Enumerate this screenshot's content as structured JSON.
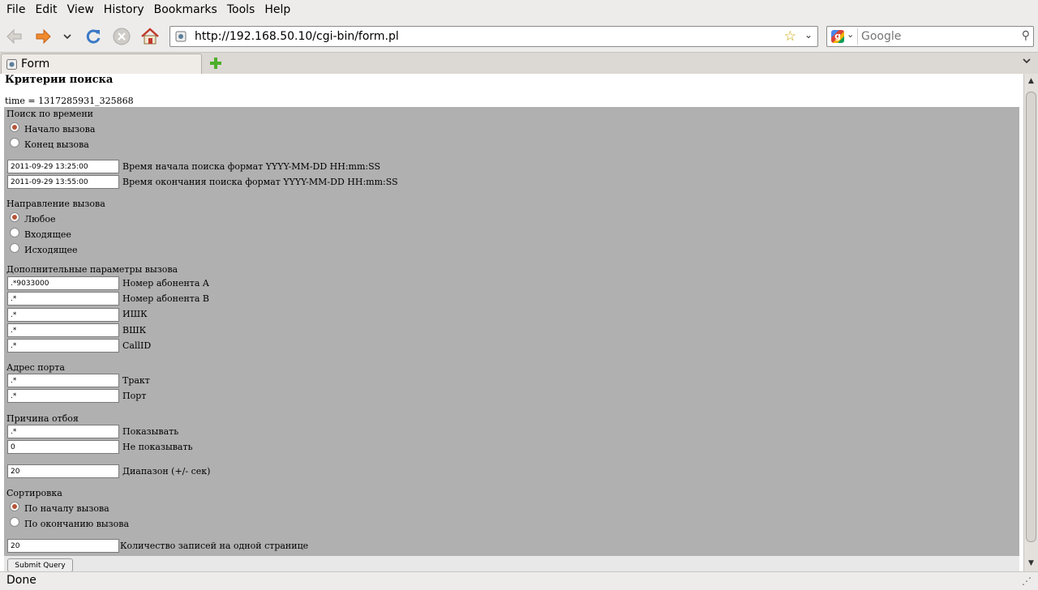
{
  "menu": {
    "file": "File",
    "edit": "Edit",
    "view": "View",
    "history": "History",
    "bookmarks": "Bookmarks",
    "tools": "Tools",
    "help": "Help"
  },
  "toolbar": {
    "url": "http://192.168.50.10/cgi-bin/form.pl",
    "search_placeholder": "Google",
    "engine_letter": "g"
  },
  "tabs": [
    {
      "label": "Form"
    }
  ],
  "page": {
    "heading": "Критерии поиска",
    "time_line": "time = 1317285931_325868",
    "time_search": {
      "legend": "Поиск по времени",
      "options": [
        "Начало вызова",
        "Конец вызова"
      ],
      "selected": 0,
      "start_value": "2011-09-29 13:25:00",
      "start_label": "Время начала поиска формат YYYY-MM-DD HH:mm:SS",
      "end_value": "2011-09-29 13:55:00",
      "end_label": "Время окончания поиска формат YYYY-MM-DD HH:mm:SS"
    },
    "direction": {
      "legend": "Направление вызова",
      "options": [
        "Любое",
        "Входящее",
        "Исходящее"
      ],
      "selected": 0
    },
    "extra": {
      "legend": "Дополнительные параметры вызова",
      "fields": [
        {
          "value": ".*9033000",
          "label": "Номер абонента A"
        },
        {
          "value": ".*",
          "label": "Номер абонента B"
        },
        {
          "value": ".*",
          "label": "ИШК"
        },
        {
          "value": ".*",
          "label": "ВШК"
        },
        {
          "value": ".*",
          "label": "CallID"
        }
      ]
    },
    "port": {
      "legend": "Адрес порта",
      "fields": [
        {
          "value": ".*",
          "label": "Тракт"
        },
        {
          "value": ".*",
          "label": "Порт"
        }
      ]
    },
    "hangup": {
      "legend": "Причина отбоя",
      "fields": [
        {
          "value": ".*",
          "label": "Показывать"
        },
        {
          "value": "0",
          "label": "Не показывать"
        }
      ]
    },
    "range": {
      "value": "20",
      "label": "Диапазон (+/- сек)"
    },
    "sort": {
      "legend": "Сортировка",
      "options": [
        "По началу вызова",
        "По окончанию вызова"
      ],
      "selected": 0
    },
    "per_page": {
      "value": "20",
      "label": "Количество записей на одной странице"
    },
    "submit": "Submit Query"
  },
  "status": {
    "text": "Done"
  },
  "colors": {
    "form_bg": "#b0b0b0",
    "radio_dot": "#b5553a"
  }
}
